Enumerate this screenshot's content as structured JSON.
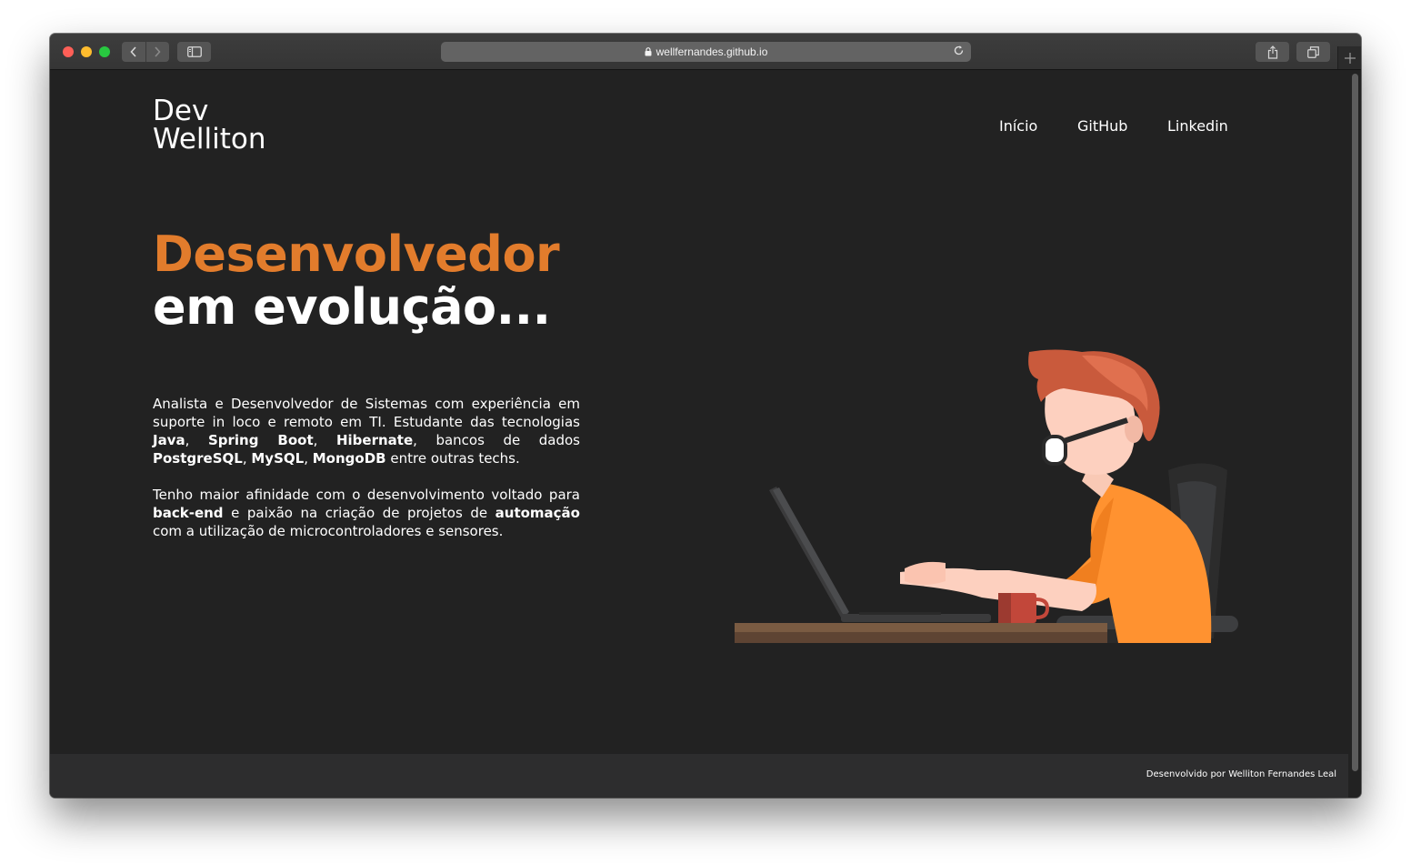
{
  "browser": {
    "url": "wellfernandes.github.io"
  },
  "site": {
    "logo_line1": "Dev",
    "logo_line2": "Welliton",
    "nav": [
      "Início",
      "GitHub",
      "Linkedin"
    ],
    "hero_accent": "Desenvolvedor",
    "hero_main": "em evolução...",
    "about_p1": [
      {
        "t": "Analista e Desenvolvedor de Sistemas com experiência em suporte in loco e remoto em TI. Estudante das tecnologias ",
        "b": false
      },
      {
        "t": "Java",
        "b": true
      },
      {
        "t": ", ",
        "b": false
      },
      {
        "t": "Spring Boot",
        "b": true
      },
      {
        "t": ", ",
        "b": false
      },
      {
        "t": "Hibernate",
        "b": true
      },
      {
        "t": ", bancos de dados ",
        "b": false
      },
      {
        "t": "PostgreSQL",
        "b": true
      },
      {
        "t": ", ",
        "b": false
      },
      {
        "t": "MySQL",
        "b": true
      },
      {
        "t": ", ",
        "b": false
      },
      {
        "t": "MongoDB",
        "b": true
      },
      {
        "t": " entre outras techs.",
        "b": false
      }
    ],
    "about_p2": [
      {
        "t": "Tenho maior afinidade com o desenvolvimento voltado para ",
        "b": false
      },
      {
        "t": "back-end",
        "b": true
      },
      {
        "t": " e paixão na criação de projetos de ",
        "b": false
      },
      {
        "t": "automação",
        "b": true
      },
      {
        "t": " com a utilização de microcontroladores e sensores.",
        "b": false
      }
    ],
    "footer": "Desenvolvido por Welliton Fernandes Leal"
  },
  "colors": {
    "accent": "#e27c2c",
    "background": "#222222",
    "footer_bg": "#2d2d2e"
  },
  "icons": {
    "lock": "lock-icon",
    "reload": "reload-icon",
    "back": "chevron-left-icon",
    "forward": "chevron-right-icon",
    "sidebar": "sidebar-icon",
    "share": "share-icon",
    "tabs": "tabs-icon",
    "new_tab": "plus-icon"
  }
}
